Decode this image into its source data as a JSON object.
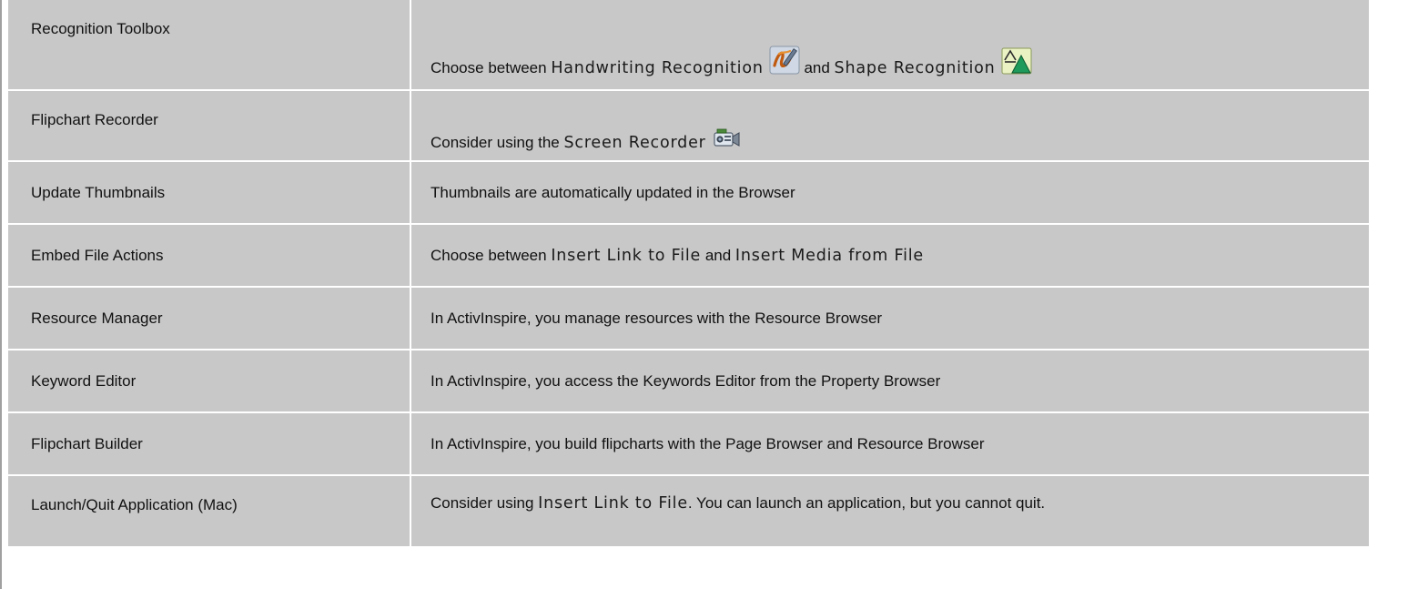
{
  "rows": [
    {
      "feature": "Recognition Toolbox",
      "text_a": "Choose between ",
      "ui_a": "Handwriting Recognition",
      "icon_a": "handwriting-recognition-icon",
      "text_b": "and ",
      "ui_b": "Shape Recognition",
      "icon_b": "shape-recognition-icon"
    },
    {
      "feature": "Flipchart Recorder",
      "text_a": "Consider using the ",
      "ui_a": "Screen Recorder",
      "icon_a": "screen-recorder-icon"
    },
    {
      "feature": "Update Thumbnails",
      "text_a": "Thumbnails are automatically updated in the Browser"
    },
    {
      "feature": "Embed File Actions",
      "text_a": "Choose between ",
      "ui_a": "Insert Link to File",
      "text_b": " and ",
      "ui_b": "Insert Media from File"
    },
    {
      "feature": "Resource Manager",
      "text_a": "In ActivInspire, you manage resources with the Resource Browser"
    },
    {
      "feature": "Keyword Editor",
      "text_a": "In ActivInspire, you access the Keywords Editor from the Property Browser"
    },
    {
      "feature": "Flipchart Builder",
      "text_a": "In ActivInspire, you build flipcharts with the Page Browser and Resource Browser"
    },
    {
      "feature": "Launch/Quit Application (Mac)",
      "text_a": "Consider using ",
      "ui_a": "Insert Link to File",
      "text_b": ". You can launch an application, but you cannot quit."
    }
  ]
}
